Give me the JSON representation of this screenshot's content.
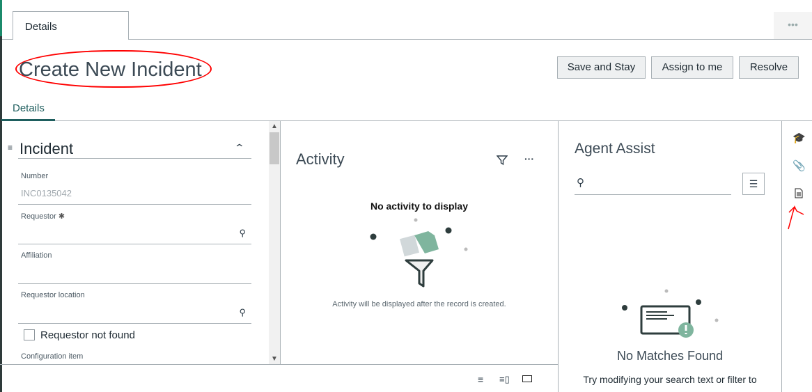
{
  "top_tab": "Details",
  "more_label": "•••",
  "page_title": "Create New Incident",
  "buttons": {
    "save_stay": "Save and Stay",
    "assign": "Assign to me",
    "resolve": "Resolve"
  },
  "sub_tab": "Details",
  "form": {
    "section_title": "Incident",
    "fields": [
      {
        "label": "Number",
        "value": "INC0135042"
      },
      {
        "label": "Requestor",
        "required_mark": "✱"
      },
      {
        "label": "Affiliation"
      },
      {
        "label": "Requestor location"
      }
    ],
    "checkbox_label": "Requestor not found",
    "next_label": "Configuration item"
  },
  "activity": {
    "title": "Activity",
    "empty_title": "No activity to display",
    "empty_text": "Activity will be displayed after the record is created."
  },
  "agent_assist": {
    "title": "Agent Assist",
    "search_value": "",
    "empty_title": "No Matches Found",
    "empty_text": "Try modifying your search text or filter to"
  },
  "colors": {
    "accent": "#1e5e5e",
    "illustration": "#7fb59e",
    "annotation": "#ff0000"
  }
}
